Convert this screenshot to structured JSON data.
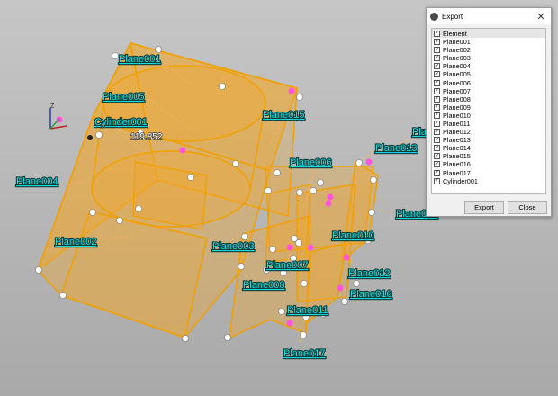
{
  "viewport": {
    "measurement": "119.852",
    "axis_labels": {
      "z": "Z",
      "y": "Y",
      "x": "X"
    },
    "labels": [
      "Plane001",
      "Plane005",
      "Cylinder001",
      "Plane015",
      "Plane004",
      "Plane006",
      "Plane013",
      "Plane002",
      "Plane003",
      "Plane010",
      "Plane007",
      "Plane008",
      "Plane012",
      "Plane016",
      "Plane011",
      "Plane017",
      "Plane009",
      "Plane014"
    ]
  },
  "dialog": {
    "title": "Export",
    "close_glyph": "✕",
    "header": "Element",
    "items": [
      "Plane001",
      "Plane002",
      "Plane003",
      "Plane004",
      "Plane005",
      "Plane006",
      "Plane007",
      "Plane008",
      "Plane009",
      "Plane010",
      "Plane011",
      "Plane012",
      "Plane013",
      "Plane014",
      "Plane015",
      "Plane016",
      "Plane017",
      "Cylinder001"
    ],
    "export_label": "Export",
    "close_label": "Close",
    "check_glyph": "✓"
  },
  "colors": {
    "surface": "#f5a623",
    "edge": "#f0a000",
    "label": "#1fe0e0",
    "pink_point": "#ff55dd",
    "white_point": "#ffffff"
  },
  "icons": {
    "app": "app-logo-icon",
    "close": "close-icon",
    "checkbox": "checkbox-checked-icon"
  }
}
